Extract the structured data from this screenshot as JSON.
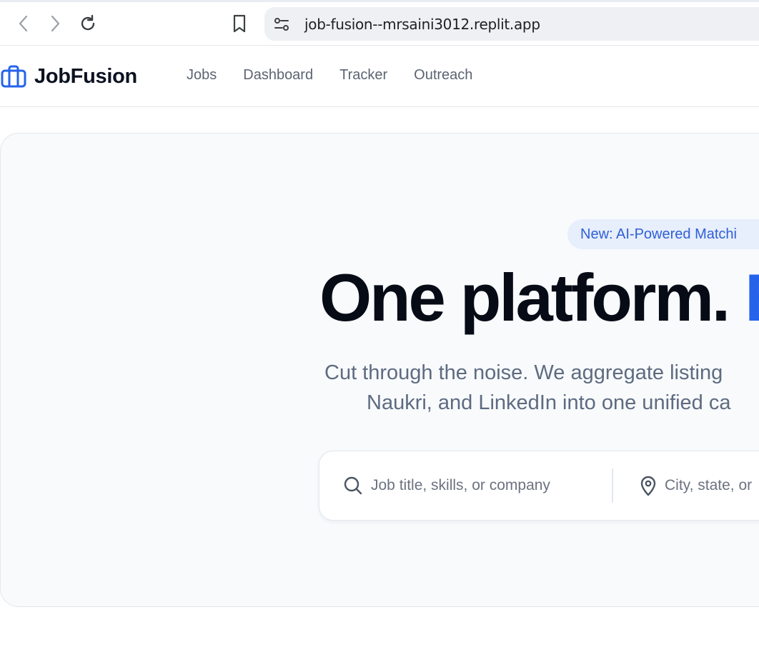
{
  "browser": {
    "url": "job-fusion--mrsaini3012.replit.app",
    "icons": {
      "back": "back-arrow-icon",
      "forward": "forward-arrow-icon",
      "reload": "reload-icon",
      "bookmark": "bookmark-icon",
      "site_settings": "site-settings-icon"
    }
  },
  "header": {
    "brand": "JobFusion",
    "logo_icon": "briefcase-icon",
    "nav": [
      {
        "label": "Jobs"
      },
      {
        "label": "Dashboard"
      },
      {
        "label": "Tracker"
      },
      {
        "label": "Outreach"
      }
    ]
  },
  "hero": {
    "badge": "New: AI-Powered Matchi",
    "headline_main": "One platform. ",
    "headline_accent": "E",
    "subtitle_line1": "Cut through the noise. We aggregate listing",
    "subtitle_line2": "Naukri, and LinkedIn into one unified ca",
    "search": {
      "query_placeholder": "Job title, skills, or company",
      "location_placeholder": "City, state, or"
    }
  },
  "colors": {
    "accent": "#2563eb",
    "badge_bg": "#e7eefc",
    "hero_bg": "#f8fafc",
    "muted_text": "#5e6b80"
  }
}
